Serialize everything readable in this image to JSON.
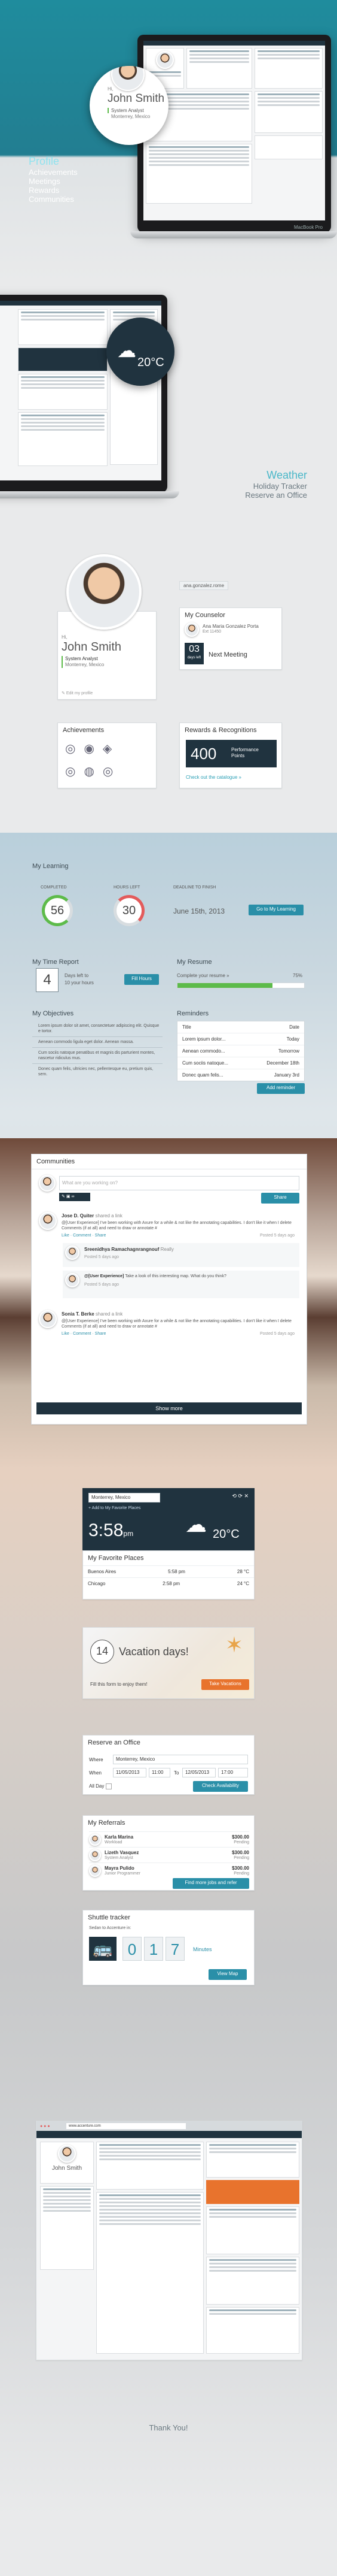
{
  "hero": {
    "menu": [
      "Profile",
      "Achievements",
      "Meetings",
      "Rewards",
      "Communities"
    ],
    "zoom_greeting": "Hi,",
    "zoom_name": "John Smith",
    "zoom_role": "System Analyst",
    "zoom_location": "Monterrey, Mexico",
    "laptop_brand": "MacBook Pro",
    "screen_logo": "accenture"
  },
  "weather_promo": {
    "title": "Weather",
    "lines": [
      "Holiday Tracker",
      "Reserve an Office"
    ],
    "zoom_temp": "20°C"
  },
  "profile": {
    "greeting": "Hi,",
    "name": "John Smith",
    "role": "System Analyst",
    "location": "Monterrey, Mexico",
    "edit_label": "Edit my profile",
    "email_tab": "ana.gonzalez.rome",
    "counselor_title": "My Counselor",
    "counselor_name": "Ana Maria Gonzalez Porta",
    "counselor_ext": "Ext 11450",
    "meeting_day": "03",
    "meeting_sub": "days left",
    "meeting_label": "Next Meeting",
    "achievements_title": "Achievements",
    "rewards_title": "Rewards & Recognitions",
    "points_value": "400",
    "points_label": "Performance Points",
    "catalogue_link": "Check out the catalogue »"
  },
  "learning": {
    "title": "My Learning",
    "completed_label": "COMPLETED",
    "completed_value": "56",
    "hours_label": "HOURS LEFT",
    "hours_value": "30",
    "deadline_label": "DEADLINE TO FINISH",
    "deadline_value": "June 15th, 2013",
    "go_button": "Go to My Learning"
  },
  "time_report": {
    "title": "My Time Report",
    "days": "4",
    "days_text": "Days left to",
    "hours_text": "10 your hours",
    "fill_button": "Fill Hours"
  },
  "resume": {
    "title": "My Resume",
    "label": "Complete your resume »",
    "percent_text": "75%",
    "percent": 0.75
  },
  "objectives": {
    "title": "My Objectives",
    "items": [
      "Lorem ipsum dolor sit amet, consectetuer adipiscing elit. Quisque e tortor.",
      "Aenean commodo ligula eget dolor. Aenean massa.",
      "Cum sociis natoque penatibus et magnis dis parturient montes, nascetur ridiculus mus.",
      "Donec quam felis, ultricies nec, pellentesque eu, pretium quis, sem."
    ]
  },
  "reminders": {
    "title": "Reminders",
    "col_title": "Title",
    "col_date": "Date",
    "rows": [
      {
        "title": "Lorem ipsum dolor...",
        "date": "Today"
      },
      {
        "title": "Aenean commodo...",
        "date": "Tomorrow"
      },
      {
        "title": "Cum sociis natoque...",
        "date": "December 18th"
      },
      {
        "title": "Donec quam felis...",
        "date": "January 3rd"
      }
    ],
    "add_button": "Add reminder"
  },
  "communities": {
    "title": "Communities",
    "placeholder": "What are you working on?",
    "share_button": "Share",
    "posts": [
      {
        "author": "Jose D. Quiter",
        "action": "shared a link",
        "text": "@[User Experience] I've been working with Axure for a while & not like the annotating capabilities. I don't like it when I delete Comments (if at all) and need to draw or annotate #",
        "meta": "Posted 5 days ago"
      },
      {
        "author": "Sreenidhya Ramachagnrangnouf",
        "action": "Really",
        "text": "",
        "meta": "Posted 5 days ago"
      },
      {
        "author": "@[User Experience]",
        "action": "",
        "text": "Take a look of this interesting map. What do you think?",
        "meta": "Posted 5 days ago"
      },
      {
        "author": "Sonia T. Berke",
        "action": "shared a link",
        "text": "@[User Experience] I've been working with Axure for a while & not like the annotating capabilities. I don't like it when I delete Comments (if at all) and need to draw or annotate #",
        "meta": "Posted 5 days ago"
      }
    ],
    "actions": [
      "Like",
      "Comment",
      "Share"
    ],
    "show_more": "Show more"
  },
  "weather_card": {
    "location": "Monterrey, Mexico",
    "add_label": "+ Add to My Favorite Places",
    "time": "3:58",
    "ampm": "pm",
    "temp": "20°C",
    "fav_title": "My Favorite Places",
    "places": [
      {
        "city": "Buenos Aires",
        "time": "5:58 pm",
        "temp": "28 °C"
      },
      {
        "city": "Chicago",
        "time": "2:58 pm",
        "temp": "24 °C"
      }
    ]
  },
  "vacation": {
    "days": "14",
    "label": "Vacation days!",
    "fill_text": "Fill this form to enjoy them!",
    "button": "Take Vacations"
  },
  "office": {
    "title": "Reserve an Office",
    "where_label": "Where",
    "where_value": "Monterrey, Mexico",
    "when_label": "When",
    "from_date": "11/05/2013",
    "from_time": "11:00",
    "to_label": "To",
    "to_date": "12/05/2013",
    "to_time": "17:00",
    "allday_label": "All Day",
    "button": "Check Availability"
  },
  "referrals": {
    "title": "My Referrals",
    "people": [
      {
        "name": "Karla Marina",
        "role": "Workload",
        "amount": "$300.00",
        "status": "Pending"
      },
      {
        "name": "Lizeth Vasquez",
        "role": "System Analyst",
        "amount": "$300.00",
        "status": "Pending"
      },
      {
        "name": "Mayra Pulido",
        "role": "Junior Programmer",
        "amount": "$300.00",
        "status": "Pending"
      }
    ],
    "button": "Find more jobs and refer"
  },
  "shuttle": {
    "title": "Shuttle tracker",
    "subtitle": "Sedan to Accenture in:",
    "digits": [
      "0",
      "1",
      "7"
    ],
    "unit": "Minutes",
    "button": "View Map"
  },
  "browser": {
    "url": "www.accenture.com",
    "profile_name": "John Smith"
  },
  "footer": {
    "thanks": "Thank You!"
  },
  "colors": {
    "teal": "#2a8fa8",
    "navy": "#20333f",
    "orange": "#e8732d",
    "green": "#5dbb4a"
  }
}
